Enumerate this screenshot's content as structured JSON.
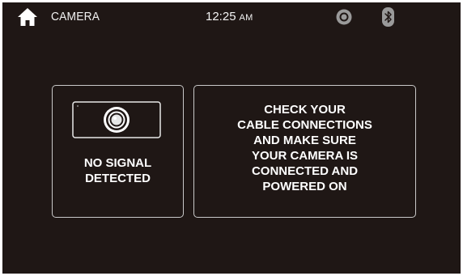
{
  "status_bar": {
    "home_icon": "home-icon",
    "title": "CAMERA",
    "time": "12:25",
    "ampm": "AM",
    "settings_icon": "settings-icon",
    "bluetooth_icon": "bluetooth-icon"
  },
  "signal_panel": {
    "camera_icon": "camera-icon",
    "message": "NO SIGNAL\nDETECTED"
  },
  "instructions_panel": {
    "message": "CHECK YOUR\nCABLE CONNECTIONS\nAND MAKE SURE\nYOUR CAMERA IS\nCONNECTED AND\nPOWERED ON"
  },
  "colors": {
    "background": "#1f1715",
    "text": "#ffffff",
    "panel_border": "#c9c9c9",
    "icon_gray": "#9a9a9a"
  }
}
